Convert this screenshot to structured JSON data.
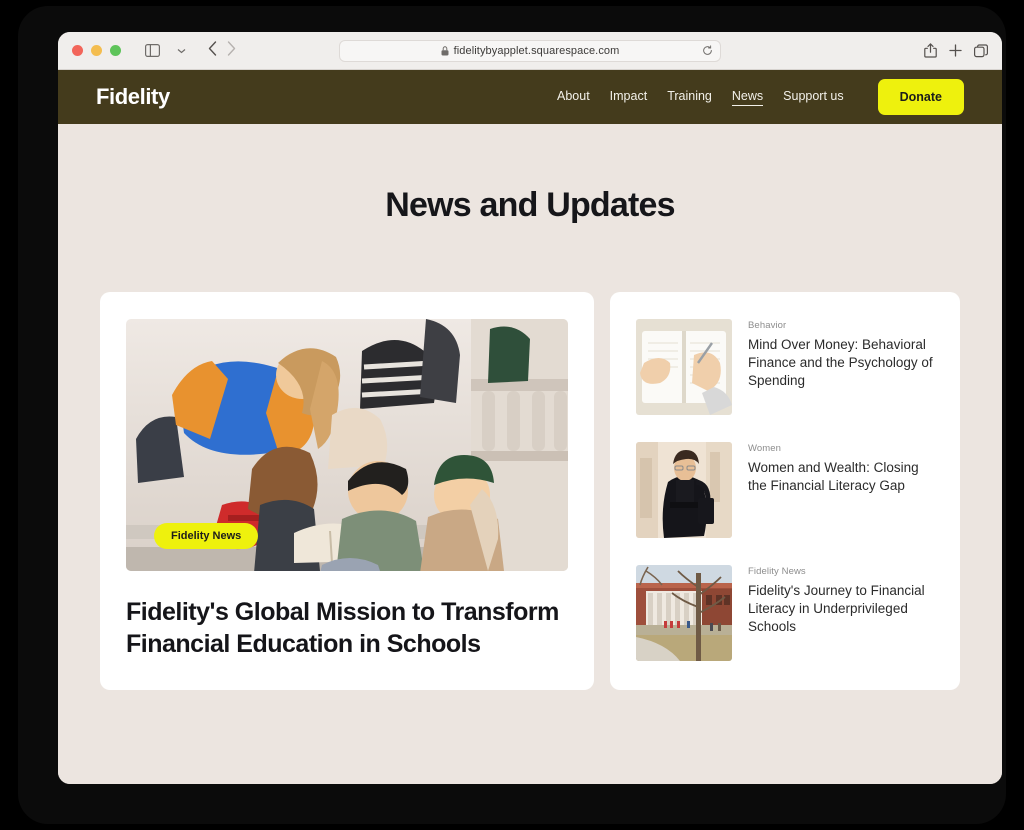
{
  "browser": {
    "url": "fidelitybyapplet.squarespace.com",
    "icons": {
      "lock": "lock-icon",
      "reload": "reload-icon",
      "sidebar": "sidebar-toggle-icon",
      "sidebar_chevron": "chevron-down-icon",
      "back": "back-arrow-icon",
      "forward": "forward-arrow-icon",
      "share": "share-icon",
      "new_tab": "plus-icon",
      "tabs": "tabs-overview-icon"
    },
    "traffic_lights": [
      "close-button",
      "minimize-button",
      "zoom-button"
    ]
  },
  "site": {
    "brand": "Fidelity",
    "nav": [
      {
        "label": "About",
        "active": false
      },
      {
        "label": "Impact",
        "active": false
      },
      {
        "label": "Training",
        "active": false
      },
      {
        "label": "News",
        "active": true
      },
      {
        "label": "Support us",
        "active": false
      }
    ],
    "donate_label": "Donate",
    "page_title": "News and Updates",
    "featured": {
      "badge": "Fidelity News",
      "title": "Fidelity's Global Mission to Transform Financial Education in Schools",
      "image_alt": "group-of-students-sitting-on-stairs-reading"
    },
    "articles": [
      {
        "category": "Behavior",
        "title": "Mind Over Money: Behavioral Finance and the Psychology of Spending",
        "image_alt": "hands-writing-in-open-notebook"
      },
      {
        "category": "Women",
        "title": "Women and Wealth: Closing the Financial Literacy Gap",
        "image_alt": "woman-in-black-blazer-walking"
      },
      {
        "category": "Fidelity News",
        "title": "Fidelity's Journey to Financial Literacy in Underprivileged Schools",
        "image_alt": "brick-campus-library-building"
      }
    ]
  },
  "colors": {
    "header": "#443b1c",
    "page_background": "#ece5e0",
    "accent_yellow": "#eef10d",
    "card": "#ffffff",
    "title_text": "#16161a"
  }
}
